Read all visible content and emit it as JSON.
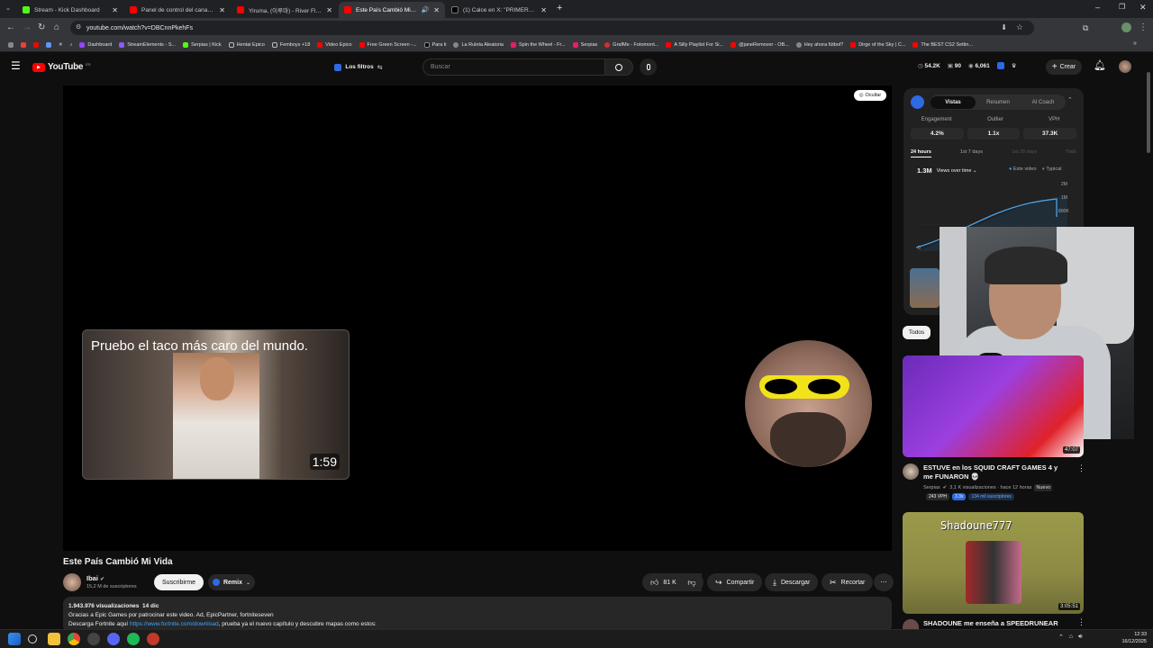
{
  "browser": {
    "tabs": [
      {
        "title": "Stream - Kick Dashboard",
        "color": "#53fc18"
      },
      {
        "title": "Panel de control del canal - Yo",
        "color": "#ff0000"
      },
      {
        "title": "Yiruma, (이루마) - River Flows i",
        "color": "#ff0000"
      },
      {
        "title": "Este País Cambió Mi Vida",
        "color": "#ff0000"
      },
      {
        "title": "(1) Calce en X: \"PRIMEROS 50 P",
        "color": "#000000"
      }
    ],
    "new_tab": "+",
    "url": "youtube.com/watch?v=DBCnnPkehFs",
    "bookmarks": [
      {
        "label": "Dashboard",
        "color": "#9146ff"
      },
      {
        "label": "StreamElements - S...",
        "color": "#8b5cf6"
      },
      {
        "label": "Serpias | Kick",
        "color": "#53fc18"
      },
      {
        "label": "Hentai Epico",
        "color": "#666666"
      },
      {
        "label": "Femboys +18",
        "color": "#666666"
      },
      {
        "label": "Video Epico",
        "color": "#ff0000"
      },
      {
        "label": "Free Green Screen -...",
        "color": "#ff0000"
      },
      {
        "label": "Para ti",
        "color": "#000000"
      },
      {
        "label": "La Ruleta Aleatoria",
        "color": "#888888"
      },
      {
        "label": "Spin the Wheel - Fr...",
        "color": "#e91e63"
      },
      {
        "label": "Serpias",
        "color": "#e91e63"
      },
      {
        "label": "GrafMe - Fotomont...",
        "color": "#d32f2f"
      },
      {
        "label": "A Silly Playlist For Si...",
        "color": "#ff0000"
      },
      {
        "label": "@janeRemover - OB...",
        "color": "#ff0000"
      },
      {
        "label": "Hey ahora fútbol?",
        "color": "#888888"
      },
      {
        "label": "Dirge of the Sky | C...",
        "color": "#ff0000"
      },
      {
        "label": "The BEST CS2 Settin...",
        "color": "#ff0000"
      }
    ]
  },
  "youtube": {
    "logo_text": "YouTube",
    "logo_sup": "ES",
    "filters_label": "Los filtros",
    "search_placeholder": "Buscar",
    "stats": {
      "views": "54.2K",
      "a": "90",
      "b": "6,061"
    },
    "create_label": "Crear"
  },
  "player": {
    "hide_label": "Ocultar",
    "card_title": "Pruebo el taco más caro del mundo.",
    "card_duration": "1:59"
  },
  "analytics": {
    "tabs": [
      "Vistas",
      "Resumen",
      "AI Coach"
    ],
    "metrics": [
      {
        "label": "Engagement",
        "value": "4.2%"
      },
      {
        "label": "Outlier",
        "value": "1.1x"
      },
      {
        "label": "VPH",
        "value": "37.3K"
      }
    ],
    "ranges": [
      "24 hours",
      "1st 7 days",
      "1st 28 days",
      "Todo"
    ],
    "total": "1.3M",
    "dropdown": "Views over time",
    "legend": [
      "Este video",
      "Typical"
    ],
    "y_ticks": [
      "2M",
      "1M",
      "800K"
    ],
    "x_start": "0"
  },
  "chips": {
    "all": "Todos"
  },
  "recommendations": [
    {
      "title": "ESTUVE en los SQUID CRAFT GAMES 4 y me FUNARON 💀",
      "channel": "Serpias",
      "meta": "3,1 K visualizaciones · hace 12 horas",
      "badge": "Nuevo",
      "vph": "243 VPH",
      "ratio": "3.3x",
      "subs": "134 mil suscriptores",
      "duration": "47:07"
    },
    {
      "title": "SHADOUNE me enseña a SPEEDRUNEAR",
      "thumb_text": "Shadoune777",
      "duration": "3:05:51"
    }
  ],
  "video": {
    "title": "Este País Cambió Mi Vida",
    "channel": "Ibai",
    "subscribers": "15,2 M de suscriptores",
    "subscribe_label": "Suscribirme",
    "remix_label": "Remix",
    "likes": "81 K",
    "share_label": "Compartir",
    "download_label": "Descargar",
    "clip_label": "Recortar",
    "views_line": "1.943.976 visualizaciones  14 dic",
    "desc_line1": "Gracias a Epic Games por patrocinar este video. Ad, EpicPartner, fortniteseven",
    "desc_line2_pre": "Descarga Fortnite aquí",
    "desc_link": "https://www.fortnite.com/download",
    "desc_line2_post": ", prueba ya el nuevo capítulo y descubre mapas como estos:"
  },
  "taskbar": {
    "time": "12:33",
    "date": "16/12/2025"
  }
}
